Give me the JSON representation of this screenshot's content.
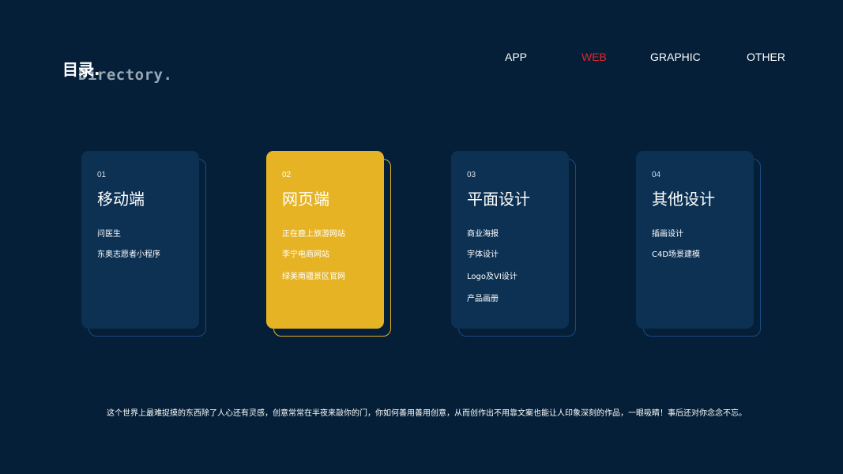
{
  "header": {
    "title_cn": "目录.",
    "title_en": "Directory."
  },
  "nav": {
    "items": [
      {
        "label": "APP"
      },
      {
        "label": "WEB",
        "active": true
      },
      {
        "label": "GRAPHIC"
      },
      {
        "label": "OTHER"
      }
    ]
  },
  "colors": {
    "background": "#041f37",
    "card": "#0c3153",
    "card_highlight": "#e6b324",
    "nav_active": "#e0262b",
    "outline": "#1c4a82"
  },
  "cards": [
    {
      "number": "01",
      "title": "移动端",
      "items": [
        "问医生",
        "东奥志愿者小程序"
      ]
    },
    {
      "number": "02",
      "title": "网页端",
      "highlight": true,
      "items": [
        "正在鹿上旅游网站",
        "李宁电商网站",
        "绿美南疆景区官网"
      ]
    },
    {
      "number": "03",
      "title": "平面设计",
      "items": [
        "商业海报",
        "字体设计",
        "Logo及VI设计",
        "产品画册"
      ]
    },
    {
      "number": "04",
      "title": "其他设计",
      "items": [
        "插画设计",
        "C4D场景建模"
      ]
    }
  ],
  "footer": {
    "text": "这个世界上最难捉摸的东西除了人心还有灵感，创意常常在半夜来敲你的门，你如何善用善用创意，从而创作出不用靠文案也能让人印象深刻的作品，一眼吸睛！事后还对你念念不忘。"
  }
}
